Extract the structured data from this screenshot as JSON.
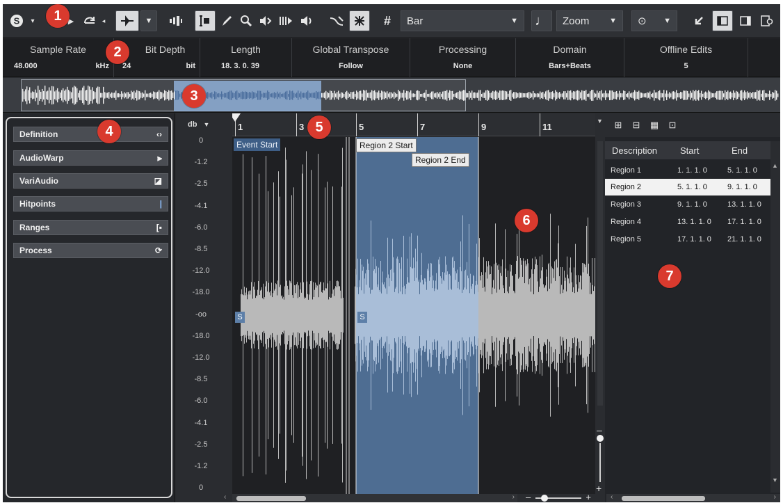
{
  "toolbar": {
    "ruler_format": "Bar",
    "zoom_label": "Zoom"
  },
  "info_line": {
    "sample_rate": {
      "label": "Sample Rate",
      "value": "48.000",
      "unit": "kHz"
    },
    "bit_depth": {
      "label": "Bit Depth",
      "value": "24",
      "unit": "bit"
    },
    "length": {
      "label": "Length",
      "value": "18. 3. 0. 39"
    },
    "global_transpose": {
      "label": "Global Transpose",
      "value": "Follow"
    },
    "processing": {
      "label": "Processing",
      "value": "None"
    },
    "domain": {
      "label": "Domain",
      "value": "Bars+Beats"
    },
    "offline_edits": {
      "label": "Offline Edits",
      "value": "5"
    }
  },
  "inspector": {
    "sections": [
      {
        "label": "Definition",
        "icon": "bracket-arrows-icon"
      },
      {
        "label": "AudioWarp",
        "icon": "warp-icon"
      },
      {
        "label": "VariAudio",
        "icon": "variaudio-icon"
      },
      {
        "label": "Hitpoints",
        "icon": "hitpoint-icon"
      },
      {
        "label": "Ranges",
        "icon": "range-icon"
      },
      {
        "label": "Process",
        "icon": "process-icon"
      }
    ]
  },
  "level_scale": {
    "header": "db",
    "labels": [
      "0",
      "-1.2",
      "-2.5",
      "-4.1",
      "-6.0",
      "-8.5",
      "-12.0",
      "-18.0",
      "-oo",
      "-18.0",
      "-12.0",
      "-8.5",
      "-6.0",
      "-4.1",
      "-2.5",
      "-1.2",
      "0"
    ]
  },
  "ruler": {
    "numbers": [
      "1",
      "3",
      "5",
      "7",
      "9",
      "11"
    ]
  },
  "markers": {
    "event_start": "Event Start",
    "region2_start": "Region 2 Start",
    "region2_end": "Region 2 End",
    "s_label": "S"
  },
  "region_list": {
    "columns": [
      "Description",
      "Start",
      "End"
    ],
    "rows": [
      {
        "description": "Region 1",
        "start": "1. 1. 1. 0",
        "end": "5. 1. 1. 0"
      },
      {
        "description": "Region 2",
        "start": "5. 1. 1. 0",
        "end": "9. 1. 1. 0"
      },
      {
        "description": "Region 3",
        "start": "9. 1. 1. 0",
        "end": "13. 1. 1. 0"
      },
      {
        "description": "Region 4",
        "start": "13. 1. 1. 0",
        "end": "17. 1. 1. 0"
      },
      {
        "description": "Region 5",
        "start": "17. 1. 1. 0",
        "end": "21. 1. 1. 0"
      }
    ],
    "selected_index": 1
  },
  "callouts": [
    "1",
    "2",
    "3",
    "4",
    "5",
    "6",
    "7"
  ]
}
